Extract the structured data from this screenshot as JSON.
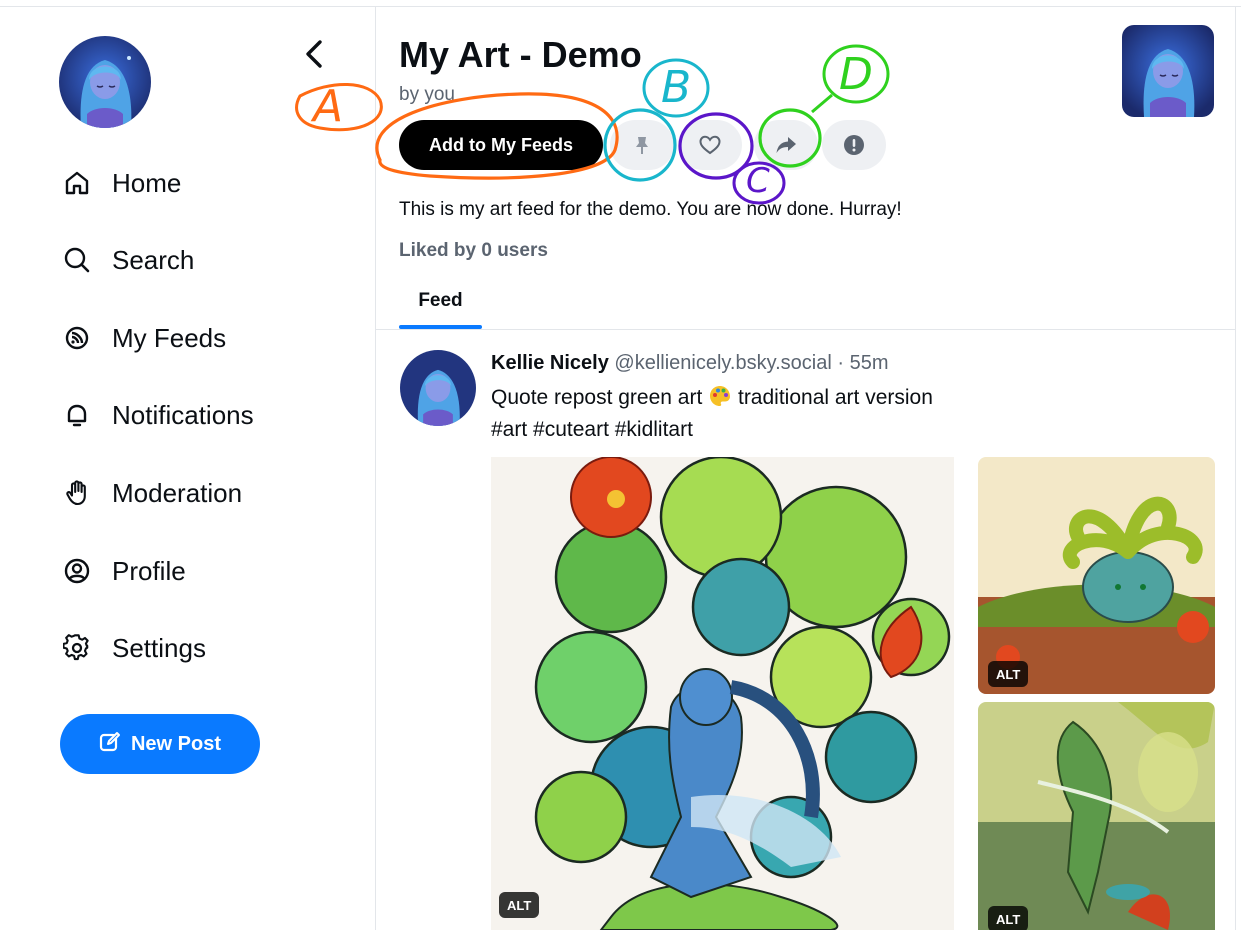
{
  "sidebar": {
    "items": [
      {
        "label": "Home",
        "icon": "home-icon"
      },
      {
        "label": "Search",
        "icon": "search-icon"
      },
      {
        "label": "My Feeds",
        "icon": "feeds-icon"
      },
      {
        "label": "Notifications",
        "icon": "bell-icon"
      },
      {
        "label": "Moderation",
        "icon": "hand-icon"
      },
      {
        "label": "Profile",
        "icon": "profile-icon"
      },
      {
        "label": "Settings",
        "icon": "gear-icon"
      }
    ],
    "new_post_label": "New Post"
  },
  "header": {
    "title": "My Art - Demo",
    "by": "by you",
    "add_label": "Add to My Feeds",
    "description": "This is my art feed for the demo. You are now done. Hurray!",
    "liked_by": "Liked by 0 users",
    "tab": "Feed",
    "action_icons": [
      "pin-icon",
      "heart-icon",
      "share-icon",
      "report-icon"
    ]
  },
  "post": {
    "name": "Kellie Nicely",
    "handle": "@kellienicely.bsky.social",
    "time": "55m",
    "text_line1_a": "Quote repost green art",
    "text_line1_b": "traditional art version",
    "text_line2": "#art #cuteart #kidlitart",
    "alt_label": "ALT"
  },
  "annotations": {
    "a": "A",
    "b": "B",
    "c": "C",
    "d": "D",
    "colors": {
      "a": "#ff6a13",
      "b": "#19b6cc",
      "c": "#5b16c9",
      "d": "#2fd11e"
    }
  },
  "colors": {
    "accent": "#0a7aff",
    "muted": "#5b6470",
    "button_bg": "#eef0f3"
  }
}
